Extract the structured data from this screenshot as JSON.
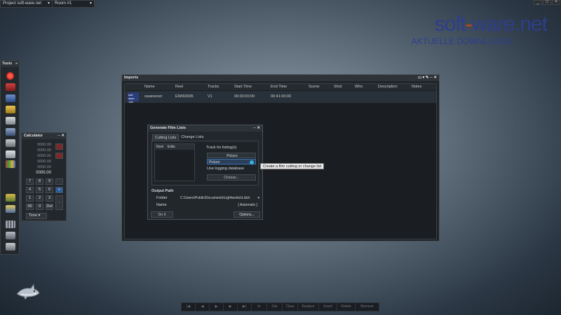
{
  "topbar": {
    "project": "Project soft-ware.net",
    "room": "Room #1"
  },
  "window_controls": [
    "_",
    "□",
    "×"
  ],
  "watermark": {
    "brand_a": "soft",
    "brand_dash": "-",
    "brand_b": "ware.net",
    "tagline": "AKTUELLE DOWNLOADS"
  },
  "tools": {
    "title": "Tools",
    "pin": "»"
  },
  "calculator": {
    "title": "Calculator",
    "lines": [
      "0000.00",
      "0000.00",
      "0000.00",
      "0000.00",
      "0000.00"
    ],
    "main": "0000.00",
    "keys": [
      "7",
      "8",
      "9",
      "+",
      "4",
      "5",
      "6",
      "+",
      "1",
      "2",
      "3",
      "-",
      "00",
      "0",
      "Del"
    ],
    "mode": "Time",
    "colors": {
      "red": "#7a2828",
      "blue": "#2b5fa0"
    }
  },
  "imports": {
    "title": "Imports",
    "columns": [
      "Name",
      "Reel",
      "Tracks",
      "Start Time",
      "End Time",
      "Scene",
      "Shot",
      "Who",
      "Description",
      "Notes"
    ],
    "rows": [
      {
        "thumb": "soft ware .net",
        "name": "swaresnet",
        "reel": "EWI60005",
        "tracks": "V1",
        "start": "00:00:00:00",
        "end": "00:41:00:00"
      }
    ]
  },
  "gfl": {
    "title": "Generate Film Lists",
    "tabs": [
      "Cutting Lists",
      "Change Lists"
    ],
    "list_headers": [
      "Reel",
      "Edits"
    ],
    "track_label": "Track for listing(s)",
    "track_header": "Picture",
    "track_value": "Picture",
    "use_db": "Use logging database",
    "choose": "Choose...",
    "output_title": "Output Path",
    "folder_label": "Folder",
    "folder_value": "C:\\Users\\Public\\Documents\\Lightworks\\Lists\\",
    "name_label": "Name",
    "name_value": "[ Automatic ]",
    "do_it": "Do It",
    "options": "Options..."
  },
  "tooltip": "Create a film cutting or change list",
  "transport": {
    "buttons": [
      "|◀",
      "◀",
      "▶",
      "▶",
      "▶|",
      "In",
      "Out",
      "Clear",
      "Replace",
      "Insert",
      "Delete",
      "Remove"
    ]
  }
}
